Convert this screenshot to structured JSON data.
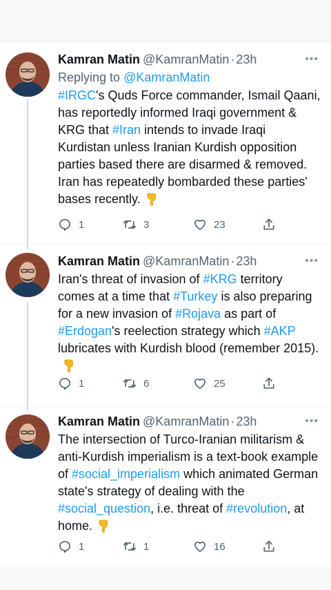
{
  "tweets": [
    {
      "name": "Kamran Matin",
      "handle": "@KamranMatin",
      "separator": "·",
      "time": "23h",
      "more": "•••",
      "reply_prefix": "Replying to",
      "reply_to": "@KamranMatin",
      "segments": [
        {
          "text": "#IRGC",
          "link": true
        },
        {
          "text": "'s Quds Force commander, Ismail Qaani, has reportedly informed Iraqi government & KRG that ",
          "link": false
        },
        {
          "text": "#Iran",
          "link": true
        },
        {
          "text": " intends to invade Iraqi Kurdistan unless Iranian Kurdish opposition parties based there are disarmed & removed. Iran has repeatedly bombarded these parties' bases recently.",
          "link": false
        }
      ],
      "emoji": "backhand-index-pointing-down",
      "replies": "1",
      "retweets": "3",
      "likes": "23"
    },
    {
      "name": "Kamran Matin",
      "handle": "@KamranMatin",
      "separator": "·",
      "time": "23h",
      "more": "•••",
      "segments": [
        {
          "text": "Iran's threat of invasion of ",
          "link": false
        },
        {
          "text": "#KRG",
          "link": true
        },
        {
          "text": " territory comes at a time that ",
          "link": false
        },
        {
          "text": "#Turkey",
          "link": true
        },
        {
          "text": " is also preparing for a new invasion of ",
          "link": false
        },
        {
          "text": "#Rojava",
          "link": true
        },
        {
          "text": " as part of ",
          "link": false
        },
        {
          "text": "#Erdogan",
          "link": true
        },
        {
          "text": "'s reelection strategy which ",
          "link": false
        },
        {
          "text": "#AKP",
          "link": true
        },
        {
          "text": " lubricates with Kurdish blood (remember 2015).",
          "link": false
        }
      ],
      "emoji": "backhand-index-pointing-down",
      "replies": "1",
      "retweets": "6",
      "likes": "25"
    },
    {
      "name": "Kamran Matin",
      "handle": "@KamranMatin",
      "separator": "·",
      "time": "23h",
      "more": "•••",
      "segments": [
        {
          "text": "The intersection of Turco-Iranian militarism & anti-Kurdish imperialism is a text-book example of ",
          "link": false
        },
        {
          "text": "#social_imperialism",
          "link": true
        },
        {
          "text": " which animated German state's strategy of dealing with the ",
          "link": false
        },
        {
          "text": "#social_question",
          "link": true
        },
        {
          "text": ", i.e. threat of ",
          "link": false
        },
        {
          "text": "#revolution",
          "link": true
        },
        {
          "text": ", at home.",
          "link": false
        }
      ],
      "emoji": "backhand-index-pointing-down",
      "replies": "1",
      "retweets": "1",
      "likes": "16"
    }
  ],
  "colors": {
    "link": "#1d9bf0",
    "text": "#0f1419",
    "secondary": "#536471",
    "background": "#ffffff",
    "band": "#f7f9f9"
  },
  "icons": [
    "reply-icon",
    "retweet-icon",
    "like-icon",
    "share-icon",
    "more-icon",
    "backhand-index-pointing-down-icon"
  ]
}
